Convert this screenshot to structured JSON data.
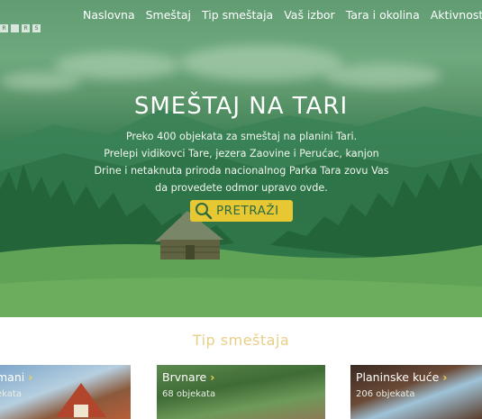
{
  "brand": {
    "logo_letters": [
      "R",
      "",
      "R",
      "S"
    ]
  },
  "nav": {
    "items": [
      {
        "label": "Naslovna"
      },
      {
        "label": "Smeštaj"
      },
      {
        "label": "Tip smeštaja"
      },
      {
        "label": "Vaš izbor"
      },
      {
        "label": "Tara i okolina"
      },
      {
        "label": "Aktivnosti"
      }
    ]
  },
  "hero": {
    "title": "SMEŠTAJ NA TARI",
    "lines": [
      "Preko 400 objekata za smeštaj na planini Tari.",
      "Prelepi vidikovci Tare, jezera Zaovine i Perućac, kanjon",
      "Drine i netaknuta priroda nacionalnog Parka Tara zovu Vas",
      "da provedete odmor upravo ovde."
    ],
    "search_label": "PRETRAŽI",
    "search_icon": "magnifier-icon"
  },
  "types": {
    "title": "Tip smeštaja",
    "cards": [
      {
        "name": "mani",
        "count": "ekata"
      },
      {
        "name": "Brvnare",
        "count": "68 objekata"
      },
      {
        "name": "Planinske kuće",
        "count": "206 objekata"
      }
    ]
  },
  "colors": {
    "accent": "#e8c832",
    "brand_green": "#2b6a43",
    "section_title": "#e6cf86"
  }
}
